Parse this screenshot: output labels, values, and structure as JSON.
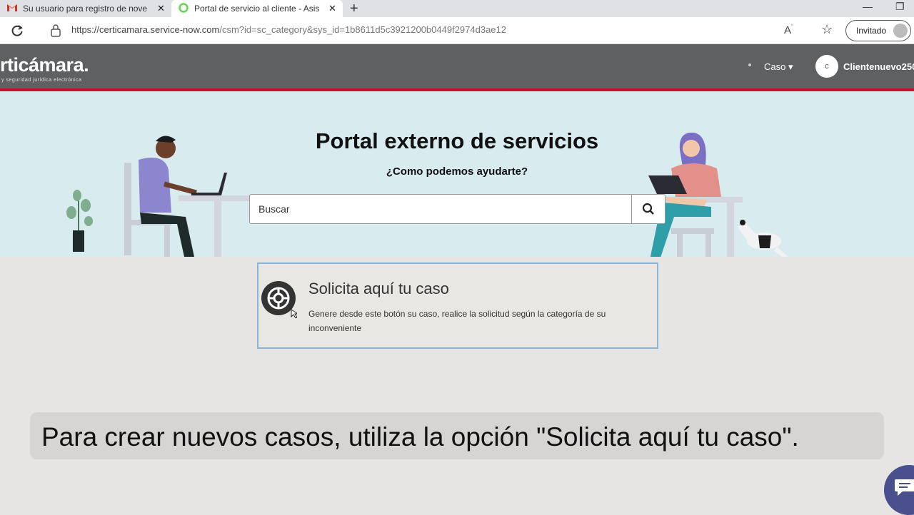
{
  "browser": {
    "tabs": [
      {
        "title": "Su usuario para registro de nove"
      },
      {
        "title": "Portal de servicio al cliente - Asis"
      }
    ],
    "new_tab_icon": "plus-icon",
    "url_host": "https://certicamara.service-now.com",
    "url_path": "/csm?id=sc_category&sys_id=1b8611d5c3921200b0449f2974d3ae12",
    "profile_label": "Invitado"
  },
  "header": {
    "logo_text": "rticámara.",
    "logo_tagline": "y seguridad jurídica electrónica",
    "nav_caso": "Caso ▾",
    "user_initial": "c",
    "user_name": "Clientenuevo250"
  },
  "hero": {
    "title": "Portal externo de servicios",
    "subtitle": "¿Como podemos ayudarte?",
    "search_placeholder": "Buscar"
  },
  "card": {
    "title": "Solicita aquí tu caso",
    "description": "Genere desde este botón su caso, realice la solicitud según la categoría de su inconveniente"
  },
  "caption": "Para crear nuevos casos, utiliza la opción \"Solicita aquí tu caso\".",
  "colors": {
    "header_bg": "#5f6061",
    "accent_red": "#c8102e",
    "hero_bg": "#d8ebef",
    "card_border": "#8bb4d4"
  }
}
